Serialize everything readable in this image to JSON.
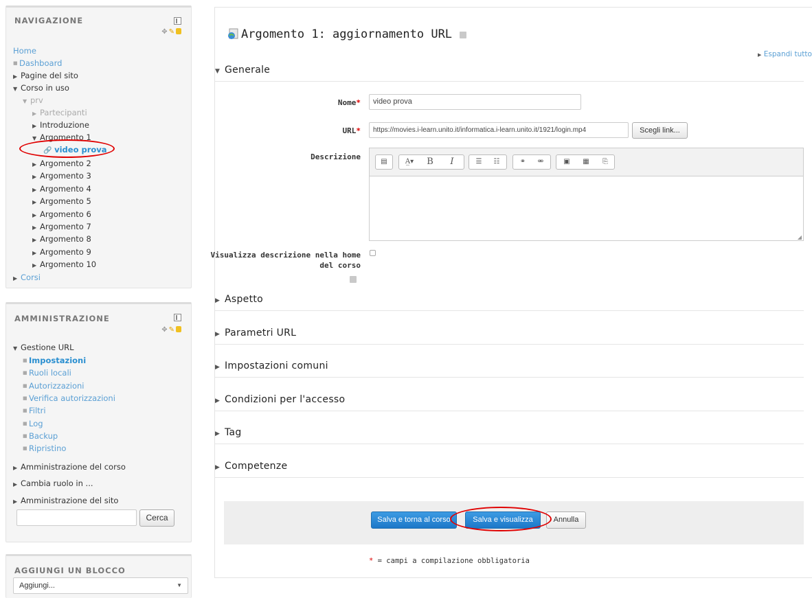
{
  "navigation": {
    "title": "NAVIGAZIONE",
    "home": "Home",
    "dashboard": "Dashboard",
    "site_pages": "Pagine del sito",
    "current_course": "Corso in uso",
    "course_short": "prv",
    "participants": "Partecipanti",
    "intro": "Introduzione",
    "topic1": "Argomento 1",
    "active_item": "video prova",
    "topics": [
      "Argomento 2",
      "Argomento 3",
      "Argomento 4",
      "Argomento 5",
      "Argomento 6",
      "Argomento 7",
      "Argomento 8",
      "Argomento 9",
      "Argomento 10"
    ],
    "courses": "Corsi"
  },
  "admin": {
    "title": "AMMINISTRAZIONE",
    "manage_url": "Gestione URL",
    "items": [
      "Impostazioni",
      "Ruoli locali",
      "Autorizzazioni",
      "Verifica autorizzazioni",
      "Filtri",
      "Log",
      "Backup",
      "Ripristino"
    ],
    "course_admin": "Amministrazione del corso",
    "switch_role": "Cambia ruolo in ...",
    "site_admin": "Amministrazione del sito",
    "search_value": "",
    "search_button": "Cerca"
  },
  "add_block": {
    "title": "AGGIUNGI UN BLOCCO",
    "select_value": "Aggiungi..."
  },
  "main": {
    "title": "Argomento 1: aggiornamento URL",
    "expand_all": "Espandi tutto",
    "general": "Generale",
    "name_label": "Nome",
    "name_value": "video prova",
    "url_label": "URL",
    "url_value": "https://movies.i-learn.unito.it/informatica.i-learn.unito.it/1921/login.mp4",
    "choose_link": "Scegli link...",
    "description_label": "Descrizione",
    "show_desc_label_1": "Visualizza descrizione nella home",
    "show_desc_label_2": "del corso",
    "sections": [
      "Aspetto",
      "Parametri URL",
      "Impostazioni comuni",
      "Condizioni per l'accesso",
      "Tag",
      "Competenze"
    ],
    "btn_save_return": "Salva e torna al corso",
    "btn_save_display": "Salva e visualizza",
    "btn_cancel": "Annulla",
    "required_note": "= campi a compilazione obbligatoria",
    "required_mark": "*"
  },
  "colors": {
    "link": "#5a9fd4",
    "highlight": "#2a8fd0",
    "required": "#dd0000",
    "annotation_oval": "#e00000",
    "primary_button": "#1d78c8"
  }
}
